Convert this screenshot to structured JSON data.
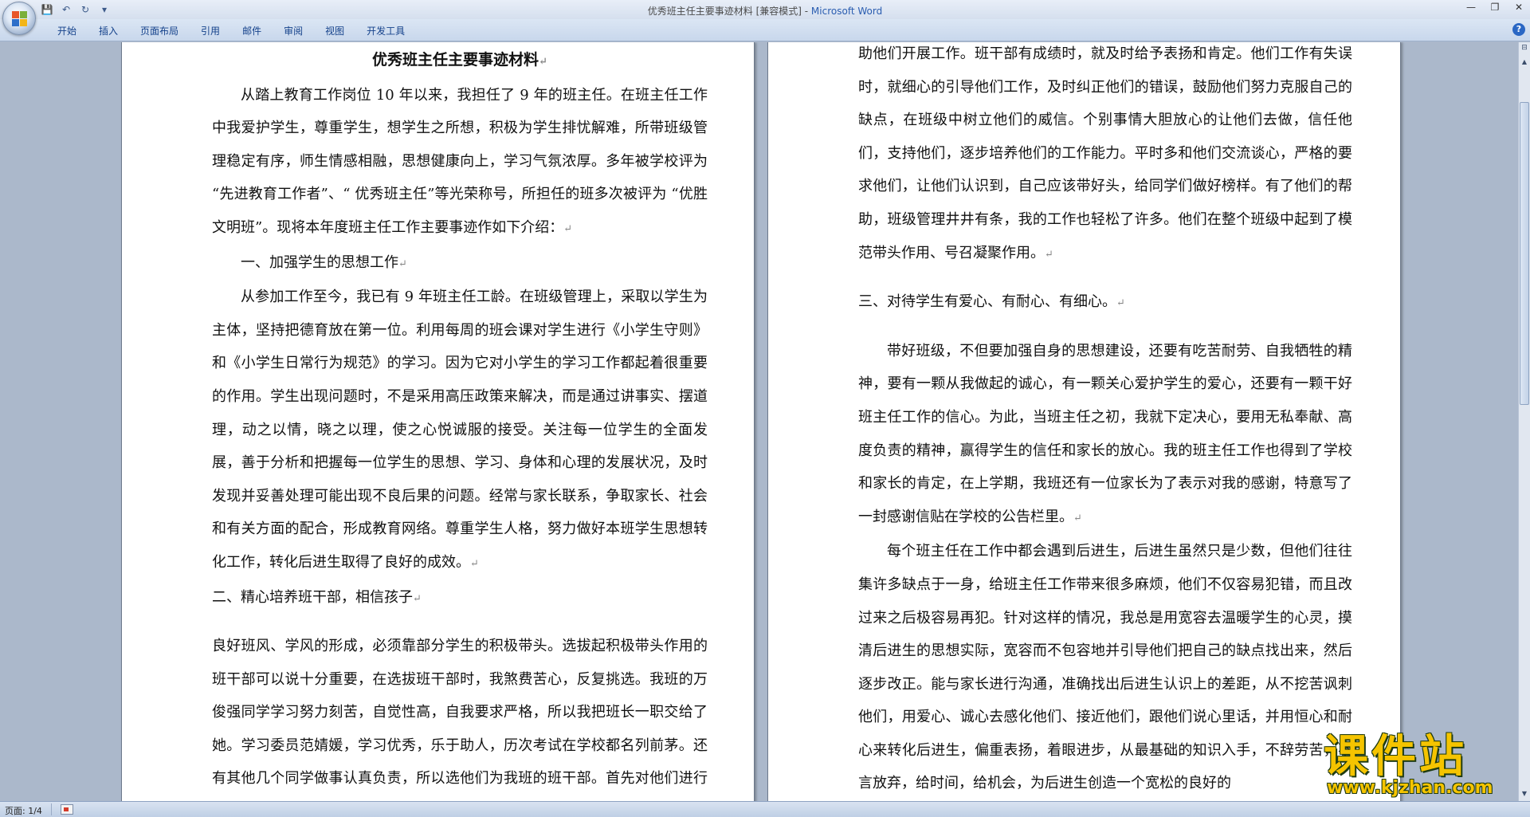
{
  "window": {
    "title": "优秀班主任主要事迹材料 [兼容模式] - ",
    "app_name": "Microsoft Word"
  },
  "qat": {
    "save": "💾",
    "undo": "↶",
    "redo": "↻",
    "customize": "▾"
  },
  "controls": {
    "minimize": "—",
    "maximize": "❐",
    "close": "✕"
  },
  "ribbon": {
    "tabs": [
      "开始",
      "插入",
      "页面布局",
      "引用",
      "邮件",
      "审阅",
      "视图",
      "开发工具"
    ],
    "help": "?"
  },
  "page1": {
    "title": "优秀班主任主要事迹材料",
    "paragraphs": [
      "从踏上教育工作岗位 10 年以来，我担任了 9 年的班主任。在班主任工作中我爱护学生，尊重学生，想学生之所想，积极为学生排忧解难，所带班级管理稳定有序，师生情感相融，思想健康向上，学习气氛浓厚。多年被学校评为 “先进教育工作者”、“ 优秀班主任”等光荣称号，所担任的班多次被评为 “优胜文明班”。现将本年度班主任工作主要事迹作如下介绍：",
      "一、加强学生的思想工作",
      "从参加工作至今，我已有 9 年班主任工龄。在班级管理上，采取以学生为主体，坚持把德育放在第一位。利用每周的班会课对学生进行《小学生守则》和《小学生日常行为规范》的学习。因为它对小学生的学习工作都起着很重要的作用。学生出现问题时，不是采用高压政策来解决，而是通过讲事实、摆道理，动之以情，晓之以理，使之心悦诚服的接受。关注每一位学生的全面发展，善于分析和把握每一位学生的思想、学习、身体和心理的发展状况，及时发现并妥善处理可能出现不良后果的问题。经常与家长联系，争取家长、社会和有关方面的配合，形成教育网络。尊重学生人格，努力做好本班学生思想转化工作，转化后进生取得了良好的成效。",
      "二、精心培养班干部，相信孩子",
      "良好班风、学风的形成，必须靠部分学生的积极带头。选拔起积极带头作用的班干部可以说十分重要，在选拔班干部时，我煞费苦心，反复挑选。我班的万俊强同学学习努力刻苦，自觉性高，自我要求严格，所以我把班长一职交给了她。学习委员范婧媛，学习优秀，乐于助人，历次考试在学校都名列前茅。还有其他几个同学做事认真负责，所以选他们为我班的班干部。首先对他们进行分工，让他们明确自己的职责，并教给他们工作的方法，发现其"
    ]
  },
  "page2": {
    "paragraphs": [
      "助他们开展工作。班干部有成绩时，就及时给予表扬和肯定。他们工作有失误时，就细心的引导他们工作，及时纠正他们的错误，鼓励他们努力克服自己的缺点，在班级中树立他们的威信。个别事情大胆放心的让他们去做，信任他们，支持他们，逐步培养他们的工作能力。平时多和他们交流谈心，严格的要求他们，让他们认识到，自己应该带好头，给同学们做好榜样。有了他们的帮助，班级管理井井有条，我的工作也轻松了许多。他们在整个班级中起到了模范带头作用、号召凝聚作用。",
      "三、对待学生有爱心、有耐心、有细心。",
      "带好班级，不但要加强自身的思想建设，还要有吃苦耐劳、自我牺牲的精神，要有一颗从我做起的诚心，有一颗关心爱护学生的爱心，还要有一颗干好班主任工作的信心。为此，当班主任之初，我就下定决心，要用无私奉献、高度负责的精神，赢得学生的信任和家长的放心。我的班主任工作也得到了学校和家长的肯定，在上学期，我班还有一位家长为了表示对我的感谢，特意写了一封感谢信贴在学校的公告栏里。",
      "每个班主任在工作中都会遇到后进生，后进生虽然只是少数，但他们往往集许多缺点于一身，给班主任工作带来很多麻烦，他们不仅容易犯错，而且改过来之后极容易再犯。针对这样的情况，我总是用宽容去温暖学生的心灵，摸清后进生的思想实际，宽容而不包容地并引导他们把自己的缺点找出来，然后逐步改正。能与家长进行沟通，准确找出后进生认识上的差距，从不挖苦讽刺他们，用爱心、诚心去感化他们、接近他们，跟他们说心里话，并用恒心和耐心来转化后进生，偏重表扬，着眼进步，从最基础的知识入手，不辞劳苦，不言放弃，给时间，给机会，为后进生创造一个宽松的良好的"
    ]
  },
  "statusbar": {
    "page_info": "页面: 1/4"
  },
  "watermark": {
    "main": "课件站",
    "url": "www.kjzhan.com"
  },
  "paragraph_mark": "↵",
  "scroll": {
    "up": "▲",
    "down": "▼",
    "ruler": "⊟"
  }
}
